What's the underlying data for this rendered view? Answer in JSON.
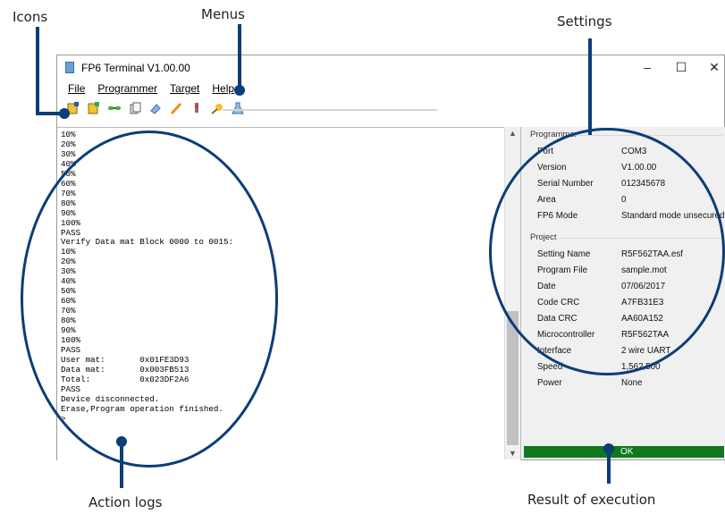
{
  "callouts": {
    "icons": "Icons",
    "menus": "Menus",
    "settings": "Settings",
    "action_logs": "Action logs",
    "result": "Result of execution"
  },
  "window": {
    "title": "FP6 Terminal V1.00.00",
    "minimize": "–",
    "maximize": "☐",
    "close": "✕"
  },
  "menu": [
    "File",
    "Programmer",
    "Target",
    "Help"
  ],
  "toolbar_icons": [
    "connect-icon",
    "settings-file-icon",
    "link-icon",
    "copy-icon",
    "erase-icon",
    "pencil-icon",
    "device-icon",
    "wand-icon",
    "flask-icon"
  ],
  "log": {
    "lines": [
      "10%",
      "20%",
      "30%",
      "40%",
      "50%",
      "60%",
      "70%",
      "80%",
      "90%",
      "100%",
      "PASS",
      "Verify Data mat Block 0000 to 0015:",
      "10%",
      "20%",
      "30%",
      "40%",
      "50%",
      "60%",
      "70%",
      "80%",
      "90%",
      "100%",
      "PASS",
      "User mat:       0x01FE3D93",
      "Data mat:       0x003FB513",
      "Total:          0x023DF2A6",
      "PASS",
      "Device disconnected.",
      "Erase,Program operation finished.",
      ">"
    ]
  },
  "settings": {
    "programmer": {
      "title": "Programmer",
      "rows": [
        {
          "k": "Port",
          "v": "COM3"
        },
        {
          "k": "Version",
          "v": "V1.00.00"
        },
        {
          "k": "Serial Number",
          "v": "012345678"
        },
        {
          "k": "Area",
          "v": "0"
        },
        {
          "k": "FP6 Mode",
          "v": "Standard mode unsecured"
        }
      ]
    },
    "project": {
      "title": "Project",
      "rows": [
        {
          "k": "Setting Name",
          "v": "R5F562TAA.esf"
        },
        {
          "k": "Program File",
          "v": "sample.mot"
        },
        {
          "k": "Date",
          "v": "07/06/2017"
        },
        {
          "k": "Code CRC",
          "v": "A7FB31E3"
        },
        {
          "k": "Data CRC",
          "v": "AA60A152"
        },
        {
          "k": "Microcontroller",
          "v": "R5F562TAA"
        },
        {
          "k": "Interface",
          "v": "2 wire UART"
        },
        {
          "k": "Speed",
          "v": "1,562,500"
        },
        {
          "k": "Power",
          "v": "None"
        }
      ]
    },
    "result": "OK",
    "result_color": "#0e7a1b"
  }
}
